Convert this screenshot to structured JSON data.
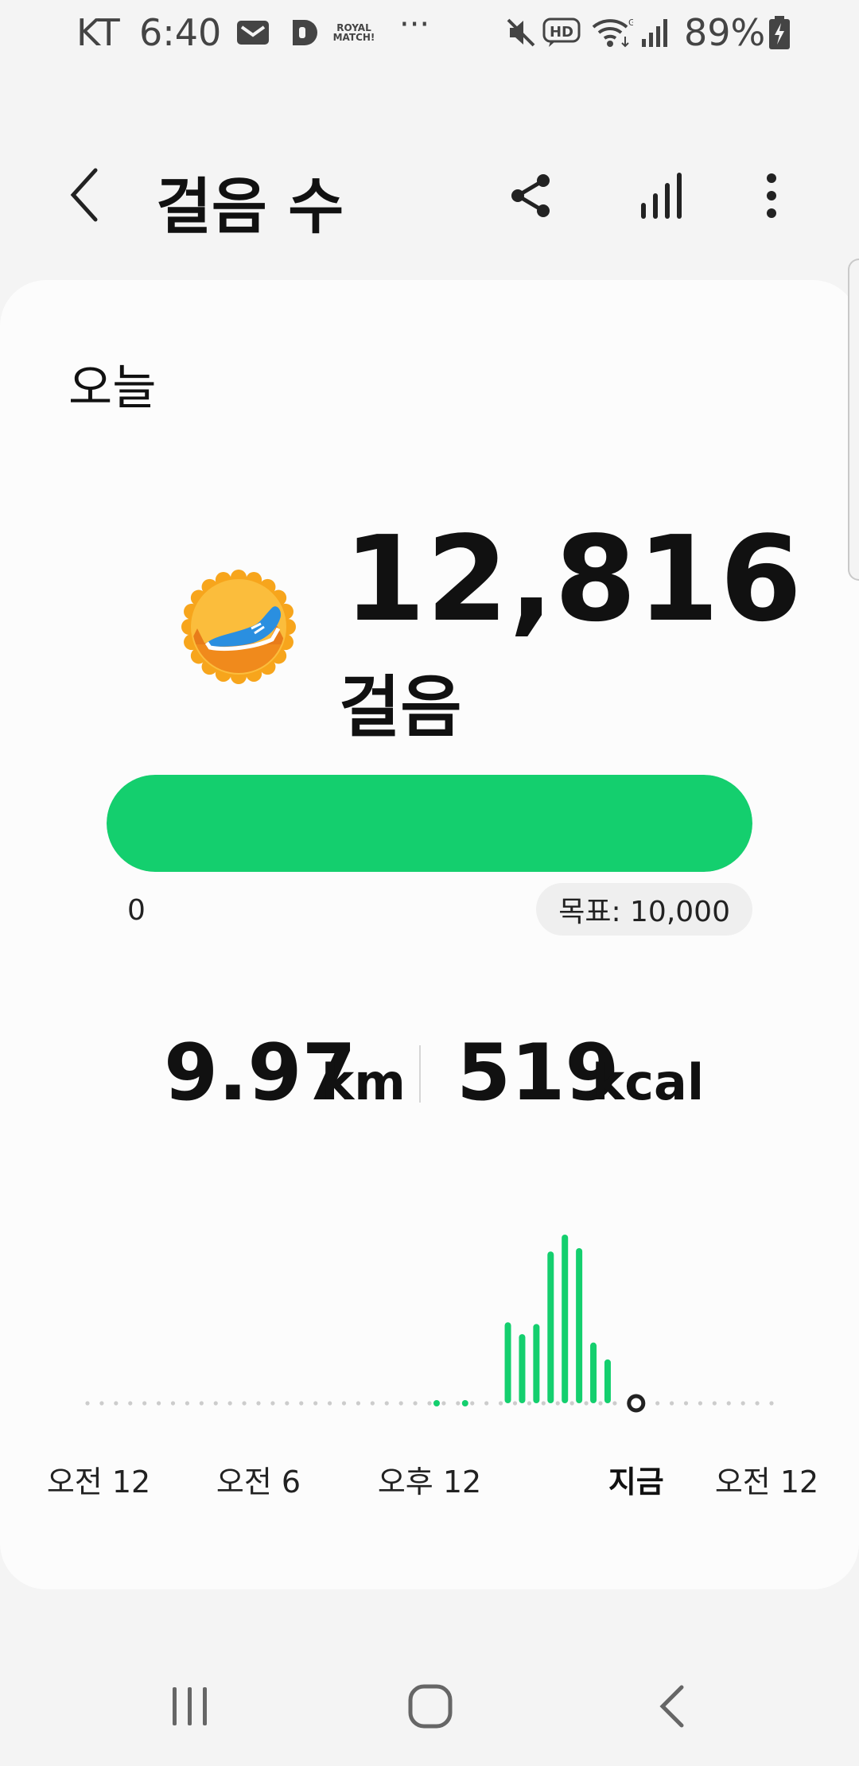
{
  "status_bar": {
    "carrier": "KT",
    "time": "6:40",
    "notification_icons": [
      "mail-icon",
      "d-app-icon",
      "royal-match-icon",
      "more-notifications-icon"
    ],
    "royal_match_text": "ROYAL MATCH!",
    "more_text": "···",
    "system_icons": [
      "mute-icon",
      "hd-voice-icon",
      "wifi-icon",
      "signal-icon",
      "battery-charging-icon"
    ],
    "hd_text": "HD",
    "battery_percent": "89%"
  },
  "app_bar": {
    "title": "걸음 수",
    "icons": [
      "back-icon",
      "share-icon",
      "stats-icon",
      "more-options-icon"
    ]
  },
  "summary": {
    "period_label": "오늘",
    "steps_value": "12,816",
    "steps_unit": "걸음",
    "progress_fraction": 1.0,
    "progress_min_label": "0",
    "goal_label": "목표: 10,000",
    "distance_value": "9.97",
    "distance_unit": "km",
    "calories_value": "519",
    "calories_unit": "kcal"
  },
  "colors": {
    "accent": "#14cf6e",
    "badge_orange": "#f7a51c",
    "shoe_blue": "#2a8fe0",
    "dots": "#cccccc"
  },
  "chart_data": {
    "type": "bar",
    "x_labels": [
      "오전 12",
      "오전 6",
      "오후 12",
      "지금",
      "오전 12"
    ],
    "bar_hours": [
      12.25,
      13.25,
      14.75,
      15.25,
      15.75,
      16.25,
      16.75,
      17.25,
      17.75,
      18.25
    ],
    "values": [
      0.01,
      0.01,
      0.48,
      0.41,
      0.47,
      0.9,
      1.0,
      0.92,
      0.36,
      0.26
    ],
    "now_hour": 19.25,
    "grid": false
  }
}
